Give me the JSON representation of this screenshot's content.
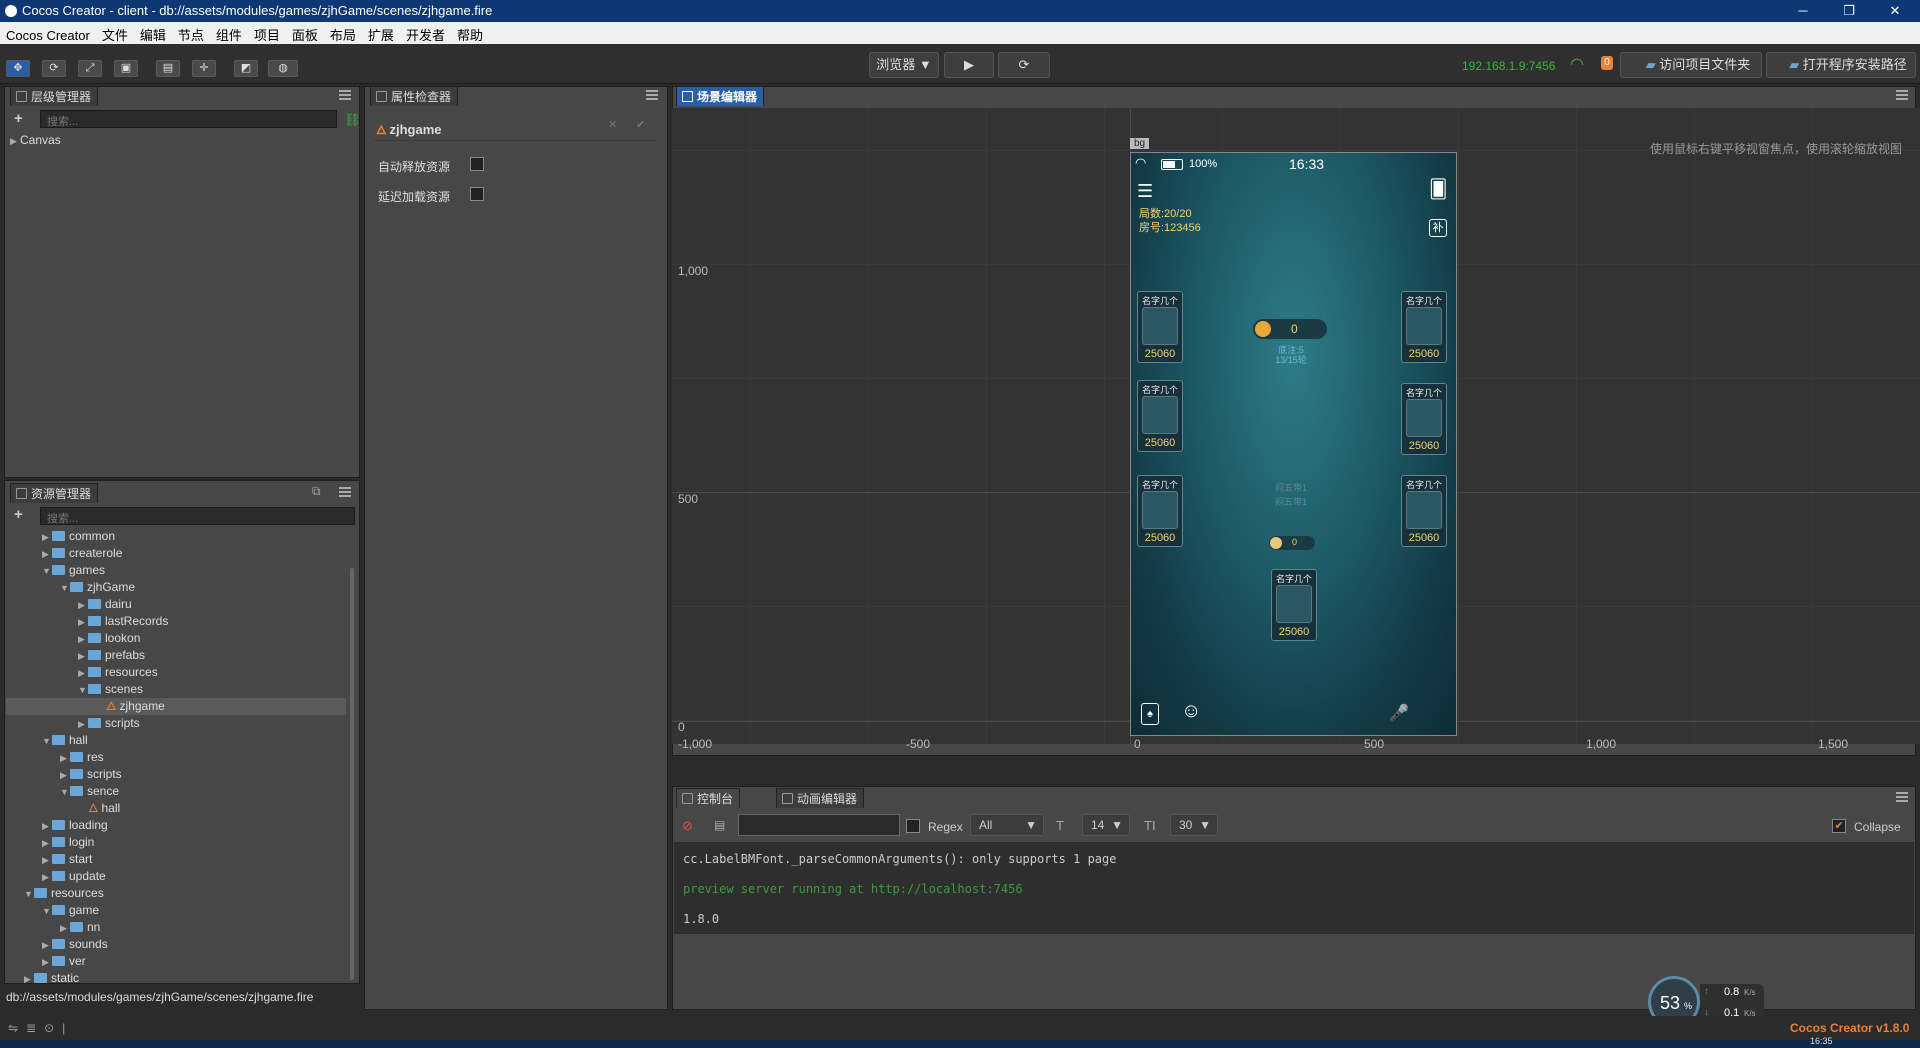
{
  "window": {
    "title": "Cocos Creator - client - db://assets/modules/games/zjhGame/scenes/zjhgame.fire",
    "minimize": "─",
    "maximize": "❐",
    "close": "✕"
  },
  "menu": [
    "Cocos Creator",
    "文件",
    "编辑",
    "节点",
    "组件",
    "项目",
    "面板",
    "布局",
    "扩展",
    "开发者",
    "帮助"
  ],
  "toolbar": {
    "browser": "浏览器 ▼",
    "play": "▶",
    "refresh": "⟳",
    "ip": "192.168.1.9:7456",
    "badge": "0",
    "open_project": "访问项目文件夹",
    "open_install": "打开程序安装路径"
  },
  "hierarchy": {
    "tab": "层级管理器",
    "search": "搜索...",
    "root": "Canvas"
  },
  "inspector": {
    "tab": "属性检查器",
    "node": "zjhgame",
    "props": [
      "自动释放资源",
      "延迟加载资源"
    ]
  },
  "assets": {
    "tab": "资源管理器",
    "search": "搜索...",
    "tree": [
      {
        "label": "common",
        "level": 2,
        "type": "folder",
        "open": false
      },
      {
        "label": "createrole",
        "level": 2,
        "type": "folder",
        "open": false
      },
      {
        "label": "games",
        "level": 2,
        "type": "folder",
        "open": true
      },
      {
        "label": "zjhGame",
        "level": 3,
        "type": "folder",
        "open": true
      },
      {
        "label": "dairu",
        "level": 4,
        "type": "folder",
        "open": false
      },
      {
        "label": "lastRecords",
        "level": 4,
        "type": "folder",
        "open": false
      },
      {
        "label": "lookon",
        "level": 4,
        "type": "folder",
        "open": false
      },
      {
        "label": "prefabs",
        "level": 4,
        "type": "folder",
        "open": false
      },
      {
        "label": "resources",
        "level": 4,
        "type": "folder",
        "open": false
      },
      {
        "label": "scenes",
        "level": 4,
        "type": "folder",
        "open": true
      },
      {
        "label": "zjhgame",
        "level": 5,
        "type": "scene",
        "selected": true
      },
      {
        "label": "scripts",
        "level": 4,
        "type": "folder",
        "open": false
      },
      {
        "label": "hall",
        "level": 2,
        "type": "folder",
        "open": true
      },
      {
        "label": "res",
        "level": 3,
        "type": "folder",
        "open": false
      },
      {
        "label": "scripts",
        "level": 3,
        "type": "folder",
        "open": false
      },
      {
        "label": "sence",
        "level": 3,
        "type": "folder",
        "open": true
      },
      {
        "label": "hall",
        "level": 4,
        "type": "scene"
      },
      {
        "label": "loading",
        "level": 2,
        "type": "folder",
        "open": false
      },
      {
        "label": "login",
        "level": 2,
        "type": "folder",
        "open": false
      },
      {
        "label": "start",
        "level": 2,
        "type": "folder",
        "open": false
      },
      {
        "label": "update",
        "level": 2,
        "type": "folder",
        "open": false
      },
      {
        "label": "resources",
        "level": 1,
        "type": "folder",
        "open": true
      },
      {
        "label": "game",
        "level": 2,
        "type": "folder",
        "open": true
      },
      {
        "label": "nn",
        "level": 3,
        "type": "folder",
        "open": false
      },
      {
        "label": "sounds",
        "level": 2,
        "type": "folder",
        "open": false
      },
      {
        "label": "ver",
        "level": 2,
        "type": "folder",
        "open": false
      },
      {
        "label": "static",
        "level": 1,
        "type": "folder",
        "open": false
      }
    ],
    "path": "db://assets/modules/games/zjhGame/scenes/zjhgame.fire"
  },
  "scene": {
    "tab": "场景编辑器",
    "hint": "使用鼠标右键平移视窗焦点，使用滚轮缩放视图",
    "node_label": "bg",
    "y_ticks": [
      "1,000",
      "500",
      "0"
    ],
    "x_ticks": [
      "-1,000",
      "-500",
      "0",
      "500",
      "1,000",
      "1,500"
    ]
  },
  "game": {
    "battery": "100%",
    "time": "16:33",
    "rounds": "局数:20/20",
    "room": "房号:123456",
    "buzhu": "补",
    "pot": "0",
    "base": "底注:5",
    "turn": "13/15轮",
    "center1": "闷五带1",
    "center2": "闷五带1",
    "bet": "0",
    "seat_name": "名字几个",
    "seat_score": "25060"
  },
  "console": {
    "tab": "控制台",
    "anim_tab": "动画编辑器",
    "regex": "Regex",
    "filter": "All",
    "font_size": "14",
    "line_height": "30",
    "collapse": "Collapse",
    "logs": [
      {
        "text": "cc.LabelBMFont._parseCommonArguments(): only supports 1 page",
        "color": "#cccccc"
      },
      {
        "text": "preview server running at http://localhost:7456",
        "color": "#3c9c3c"
      },
      {
        "text": "1.8.0",
        "color": "#cccccc"
      }
    ]
  },
  "status": {
    "version": "Cocos Creator v1.8.0",
    "cpu": "53",
    "cpu_unit": "%",
    "up": "0.8",
    "down": "0.1",
    "rate_unit": "K/s",
    "clock": "16:35"
  }
}
